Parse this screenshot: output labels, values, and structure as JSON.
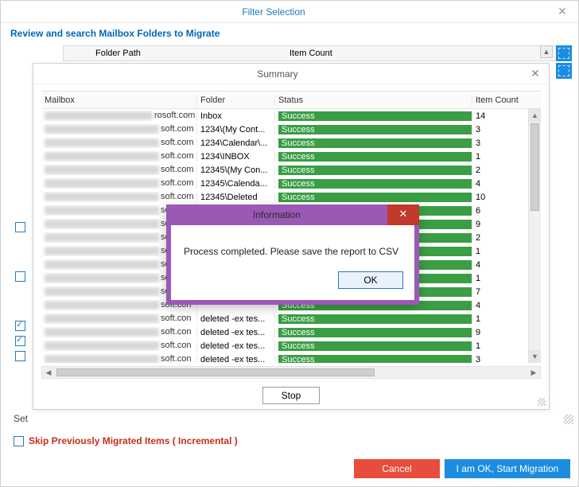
{
  "window": {
    "title": "Filter Selection",
    "subtitle": "Review and search Mailbox Folders to Migrate"
  },
  "bg_headers": {
    "folder_path": "Folder Path",
    "item_count": "Item Count"
  },
  "left_checks": [
    {
      "checked": false
    },
    {
      "checked": false
    },
    {
      "checked": true
    },
    {
      "checked": true
    },
    {
      "checked": false
    }
  ],
  "set_label": "Set",
  "summary": {
    "title": "Summary",
    "headers": {
      "mailbox": "Mailbox",
      "folder": "Folder",
      "status": "Status",
      "item_count": "Item Count"
    },
    "rows": [
      {
        "suffix": "rosoft.com",
        "suffix_w": 52,
        "folder": "Inbox",
        "status": "Success",
        "count": 14
      },
      {
        "suffix": "soft.com",
        "suffix_w": 44,
        "folder": "1234\\(My Cont...",
        "status": "Success",
        "count": 3
      },
      {
        "suffix": "soft.com",
        "suffix_w": 44,
        "folder": "1234\\Calendar\\...",
        "status": "Success",
        "count": 3
      },
      {
        "suffix": "soft.com",
        "suffix_w": 44,
        "folder": "1234\\INBOX",
        "status": "Success",
        "count": 1
      },
      {
        "suffix": "soft.com",
        "suffix_w": 44,
        "folder": "12345\\(My Con...",
        "status": "Success",
        "count": 2
      },
      {
        "suffix": "soft.com",
        "suffix_w": 44,
        "folder": "12345\\Calenda...",
        "status": "Success",
        "count": 4
      },
      {
        "suffix": "soft.com",
        "suffix_w": 44,
        "folder": "12345\\Deleted",
        "status": "Success",
        "count": 10
      },
      {
        "suffix": "soft.com",
        "suffix_w": 44,
        "folder": "",
        "status": "Success",
        "count": 6
      },
      {
        "suffix": "soft.com",
        "suffix_w": 44,
        "folder": "",
        "status": "Success",
        "count": 9
      },
      {
        "suffix": "soft.com",
        "suffix_w": 44,
        "folder": "",
        "status": "Success",
        "count": 2
      },
      {
        "suffix": "soft.com",
        "suffix_w": 44,
        "folder": "",
        "status": "Success",
        "count": 1
      },
      {
        "suffix": "soft.com",
        "suffix_w": 44,
        "folder": "",
        "status": "Success",
        "count": 4
      },
      {
        "suffix": "soft.con",
        "suffix_w": 44,
        "folder": "",
        "status": "Success",
        "count": 1
      },
      {
        "suffix": "soft.con",
        "suffix_w": 44,
        "folder": "",
        "status": "Success",
        "count": 7
      },
      {
        "suffix": "soft.con",
        "suffix_w": 44,
        "folder": "",
        "status": "Success",
        "count": 4
      },
      {
        "suffix": "soft.con",
        "suffix_w": 44,
        "folder": "deleted -ex tes...",
        "status": "Success",
        "count": 1
      },
      {
        "suffix": "soft.con",
        "suffix_w": 44,
        "folder": "deleted -ex tes...",
        "status": "Success",
        "count": 9
      },
      {
        "suffix": "soft.con",
        "suffix_w": 44,
        "folder": "deleted -ex tes...",
        "status": "Success",
        "count": 1
      },
      {
        "suffix": "soft.con",
        "suffix_w": 44,
        "folder": "deleted -ex tes...",
        "status": "Success",
        "count": 3
      }
    ],
    "stop_label": "Stop"
  },
  "info_dialog": {
    "title": "Information",
    "message": "Process completed. Please save the report to CSV",
    "ok_label": "OK"
  },
  "skip_label": "Skip Previously Migrated Items ( Incremental )",
  "buttons": {
    "cancel": "Cancel",
    "start": "I am OK, Start Migration"
  }
}
